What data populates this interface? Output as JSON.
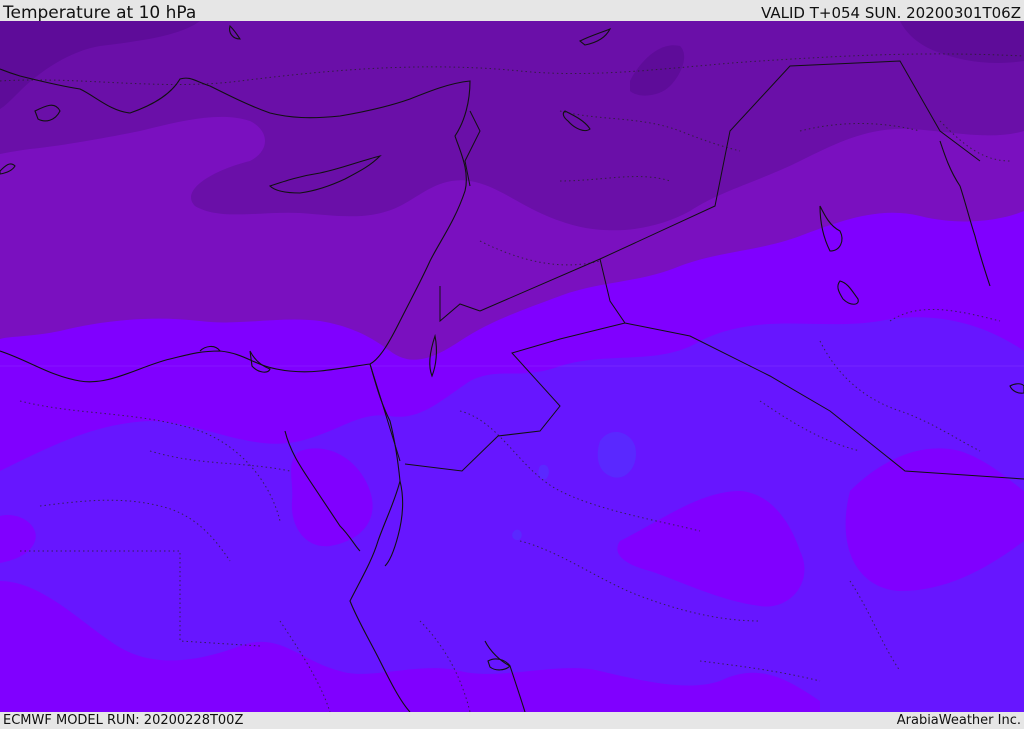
{
  "header": {
    "title": "Temperature at 10 hPa",
    "valid": "VALID T+054 SUN. 20200301T06Z"
  },
  "footer": {
    "model_run": "ECMWF MODEL RUN: 20200228T00Z",
    "credit": "ArabiaWeather Inc."
  },
  "colors": {
    "band_coldest": "#6a0fa8",
    "band_cold": "#7a10bf",
    "band_mid": "#8000ff",
    "band_warm": "#6716ff",
    "band_warmest": "#5a28ff",
    "coastline": "#111111",
    "border": "#1a1a1a",
    "background": "#e6e6e6"
  }
}
